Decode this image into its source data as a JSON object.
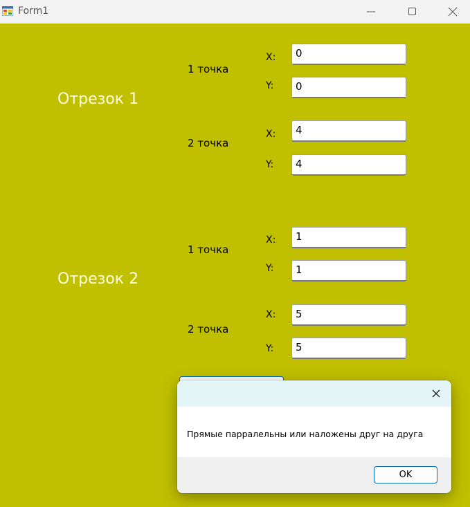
{
  "window": {
    "title": "Form1",
    "icon": "winforms-app-icon",
    "controls": [
      "minimize-icon",
      "maximize-icon",
      "close-icon"
    ]
  },
  "colors": {
    "form_background": "#c0c000",
    "segment_label": "#fffce0",
    "dialog_header": "#e4f5f7",
    "dialog_footer": "#f0f0f0",
    "accent_border": "#0067c0"
  },
  "segments": [
    {
      "label": "Отрезок 1",
      "points": [
        {
          "label": "1 точка",
          "x_label": "X:",
          "x_value": "0",
          "y_label": "Y:",
          "y_value": "0"
        },
        {
          "label": "2 точка",
          "x_label": "X:",
          "x_value": "4",
          "y_label": "Y:",
          "y_value": "4"
        }
      ]
    },
    {
      "label": "Отрезок 2",
      "points": [
        {
          "label": "1 точка",
          "x_label": "X:",
          "x_value": "1",
          "y_label": "Y:",
          "y_value": "1"
        },
        {
          "label": "2 точка",
          "x_label": "X:",
          "x_value": "5",
          "y_label": "Y:",
          "y_value": "5"
        }
      ]
    }
  ],
  "dialog": {
    "message": "Прямые парралельны или наложены друг на друга",
    "ok_label": "OK",
    "close_icon": "close-icon"
  }
}
